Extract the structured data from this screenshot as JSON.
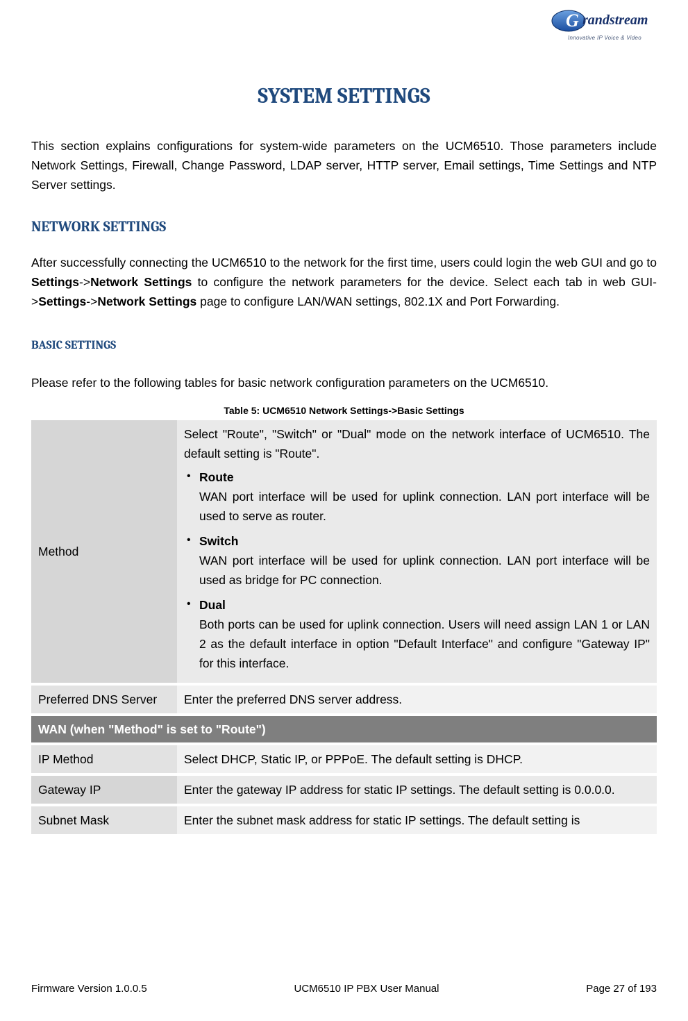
{
  "logo": {
    "brand_line1": "randstream",
    "tagline": "Innovative IP Voice & Video"
  },
  "title": "SYSTEM SETTINGS",
  "intro": "This section explains configurations for system-wide parameters on the UCM6510. Those parameters include Network Settings, Firewall, Change Password, LDAP server, HTTP server, Email settings, Time Settings and NTP Server settings.",
  "section_network": {
    "heading": "NETWORK SETTINGS",
    "para_parts": {
      "p1": "After successfully connecting the UCM6510 to the network for the first time, users could login the web GUI and go to ",
      "b1": "Settings",
      "arrow1": "->",
      "b2": "Network Settings",
      "p2": " to configure the network parameters for the device. Select each tab in web GUI->",
      "b3": "Settings",
      "arrow2": "->",
      "b4": "Network Settings",
      "p3": " page to configure LAN/WAN settings, 802.1X and Port Forwarding."
    }
  },
  "section_basic": {
    "heading": "BASIC SETTINGS",
    "intro": "Please refer to the following tables for basic network configuration parameters on the UCM6510.",
    "table_caption": "Table 5: UCM6510 Network Settings->Basic Settings"
  },
  "table": {
    "rows": [
      {
        "label": "Method",
        "intro": "Select \"Route\", \"Switch\" or \"Dual\" mode on the network interface of UCM6510. The default setting is \"Route\".",
        "bullets": [
          {
            "title": "Route",
            "desc": "WAN port interface will be used for uplink connection. LAN port interface will be used to serve as router."
          },
          {
            "title": "Switch",
            "desc": "WAN port interface will be used for uplink connection. LAN port interface will be used as bridge for PC connection."
          },
          {
            "title": "Dual",
            "desc": "Both ports can be used for uplink connection. Users will need assign LAN 1 or LAN 2 as the default interface in option \"Default Interface\" and configure \"Gateway IP\" for this interface."
          }
        ]
      },
      {
        "label": "Preferred DNS Server",
        "value": "Enter the preferred DNS server address."
      }
    ],
    "section_header": "WAN (when \"Method\" is set to \"Route\")",
    "rows2": [
      {
        "label": "IP Method",
        "value": "Select DHCP, Static IP, or PPPoE. The default setting is DHCP."
      },
      {
        "label": "Gateway IP",
        "value": "Enter the gateway IP address for static IP settings. The default setting is 0.0.0.0."
      },
      {
        "label": "Subnet Mask",
        "value": "Enter the subnet mask address for static IP settings. The default setting is"
      }
    ]
  },
  "footer": {
    "left": "Firmware Version 1.0.0.5",
    "center": "UCM6510 IP PBX User Manual",
    "right": "Page 27 of 193"
  }
}
